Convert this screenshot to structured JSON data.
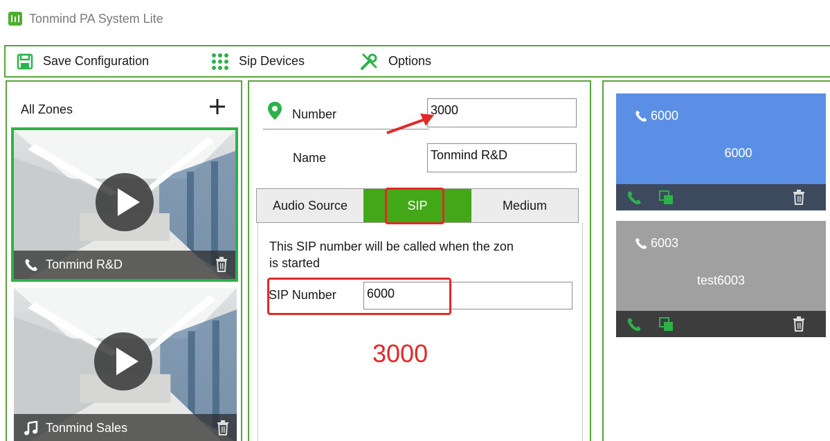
{
  "app": {
    "title": "Tonmind PA System Lite"
  },
  "toolbar": {
    "save_label": "Save Configuration",
    "sip_devices_label": "Sip Devices",
    "options_label": "Options"
  },
  "zones": {
    "header": "All Zones",
    "items": [
      {
        "name": "Tonmind R&D",
        "type_icon": "phone-icon",
        "selected": true
      },
      {
        "name": "Tonmind Sales",
        "type_icon": "music-note-icon",
        "selected": false
      }
    ]
  },
  "zone_editor": {
    "number_label": "Number",
    "number_value": "3000",
    "name_label": "Name",
    "name_value": "Tonmind R&D",
    "tabs": [
      {
        "label": "Audio Source",
        "active": false
      },
      {
        "label": "SIP",
        "active": true
      },
      {
        "label": "Medium",
        "active": false
      }
    ],
    "sip_description": "This SIP number will be called when the zon\nis started",
    "sip_number_label": "SIP Number",
    "sip_number_value": "6000"
  },
  "annotations": {
    "big_number": "3000"
  },
  "devices": [
    {
      "number": "6000",
      "name": "6000",
      "active": true
    },
    {
      "number": "6003",
      "name": "test6003",
      "active": false
    }
  ],
  "colors": {
    "accent_green": "#5aa339",
    "tab_active": "#42a818",
    "device_active": "#5b8fe6",
    "device_inactive": "#a0a0a0",
    "device_bar": "#3d3d3d",
    "annotation_red": "#e3282a"
  }
}
